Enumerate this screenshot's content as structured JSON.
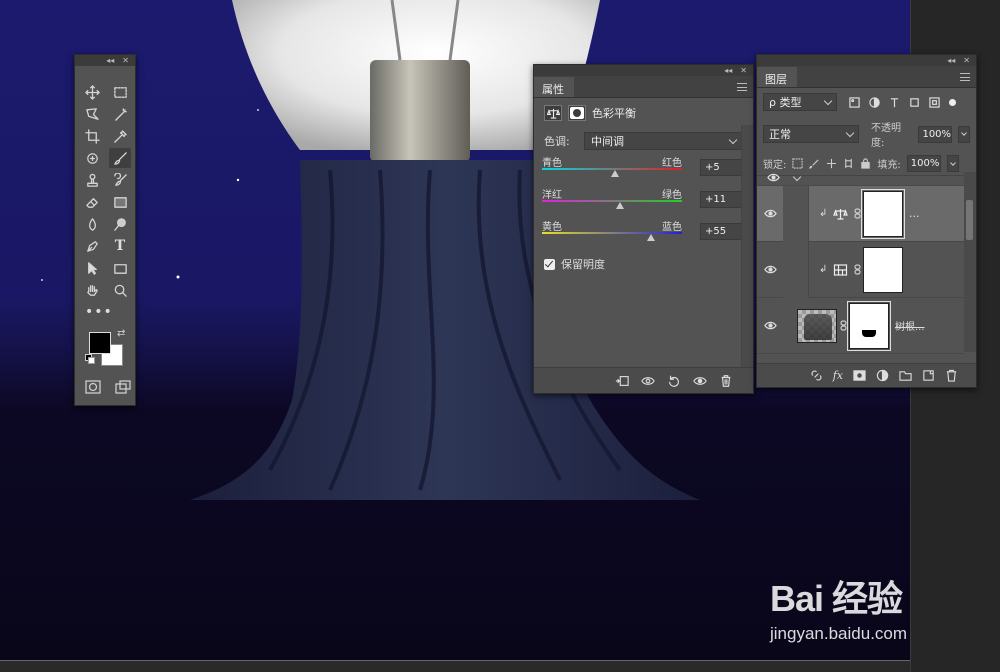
{
  "toolbar": {
    "more_glyph": "•••",
    "tools": [
      {
        "name": "move-tool"
      },
      {
        "name": "marquee-tool"
      },
      {
        "name": "lasso-tool"
      },
      {
        "name": "magic-wand-tool"
      },
      {
        "name": "crop-tool"
      },
      {
        "name": "eyedropper-tool"
      },
      {
        "name": "healing-brush-tool"
      },
      {
        "name": "brush-tool"
      },
      {
        "name": "clone-stamp-tool"
      },
      {
        "name": "history-brush-tool"
      },
      {
        "name": "eraser-tool"
      },
      {
        "name": "gradient-tool"
      },
      {
        "name": "blur-tool"
      },
      {
        "name": "dodge-tool"
      },
      {
        "name": "pen-tool"
      },
      {
        "name": "type-tool",
        "glyph": "T"
      },
      {
        "name": "path-selection-tool"
      },
      {
        "name": "rectangle-tool"
      },
      {
        "name": "hand-tool"
      },
      {
        "name": "zoom-tool"
      }
    ],
    "foreground_color": "#000000",
    "background_color": "#ffffff"
  },
  "properties": {
    "tab_label": "属性",
    "title": "色彩平衡",
    "tone_label": "色调:",
    "tone_value": "中间调",
    "sliders": [
      {
        "left": "青色",
        "right": "红色",
        "value": "+5",
        "gradient": "linear-gradient(90deg,#00d8e0,#e02020)",
        "level": 0.52
      },
      {
        "left": "洋红",
        "right": "绿色",
        "value": "+11",
        "gradient": "linear-gradient(90deg,#e020e0,#20d020)",
        "level": 0.555
      },
      {
        "left": "黄色",
        "right": "蓝色",
        "value": "+55",
        "gradient": "linear-gradient(90deg,#e8e020,#2020e0)",
        "level": 0.775
      }
    ],
    "preserve_label": "保留明度",
    "preserve_checked": true
  },
  "layers": {
    "tab_label": "图层",
    "filter_label": "类型",
    "filter_glyph": "ρ",
    "blend_mode": "正常",
    "opacity_label": "不透明度:",
    "opacity_value": "100%",
    "lock_label": "锁定:",
    "fill_label": "填充:",
    "fill_value": "100%",
    "rows": [
      {
        "type": "color-balance",
        "more": "..."
      },
      {
        "type": "levels"
      },
      {
        "type": "image",
        "name": "树根..."
      }
    ],
    "fx_label": "fx"
  },
  "watermark": {
    "logo": "Bai  经验",
    "url": "jingyan.baidu.com"
  }
}
